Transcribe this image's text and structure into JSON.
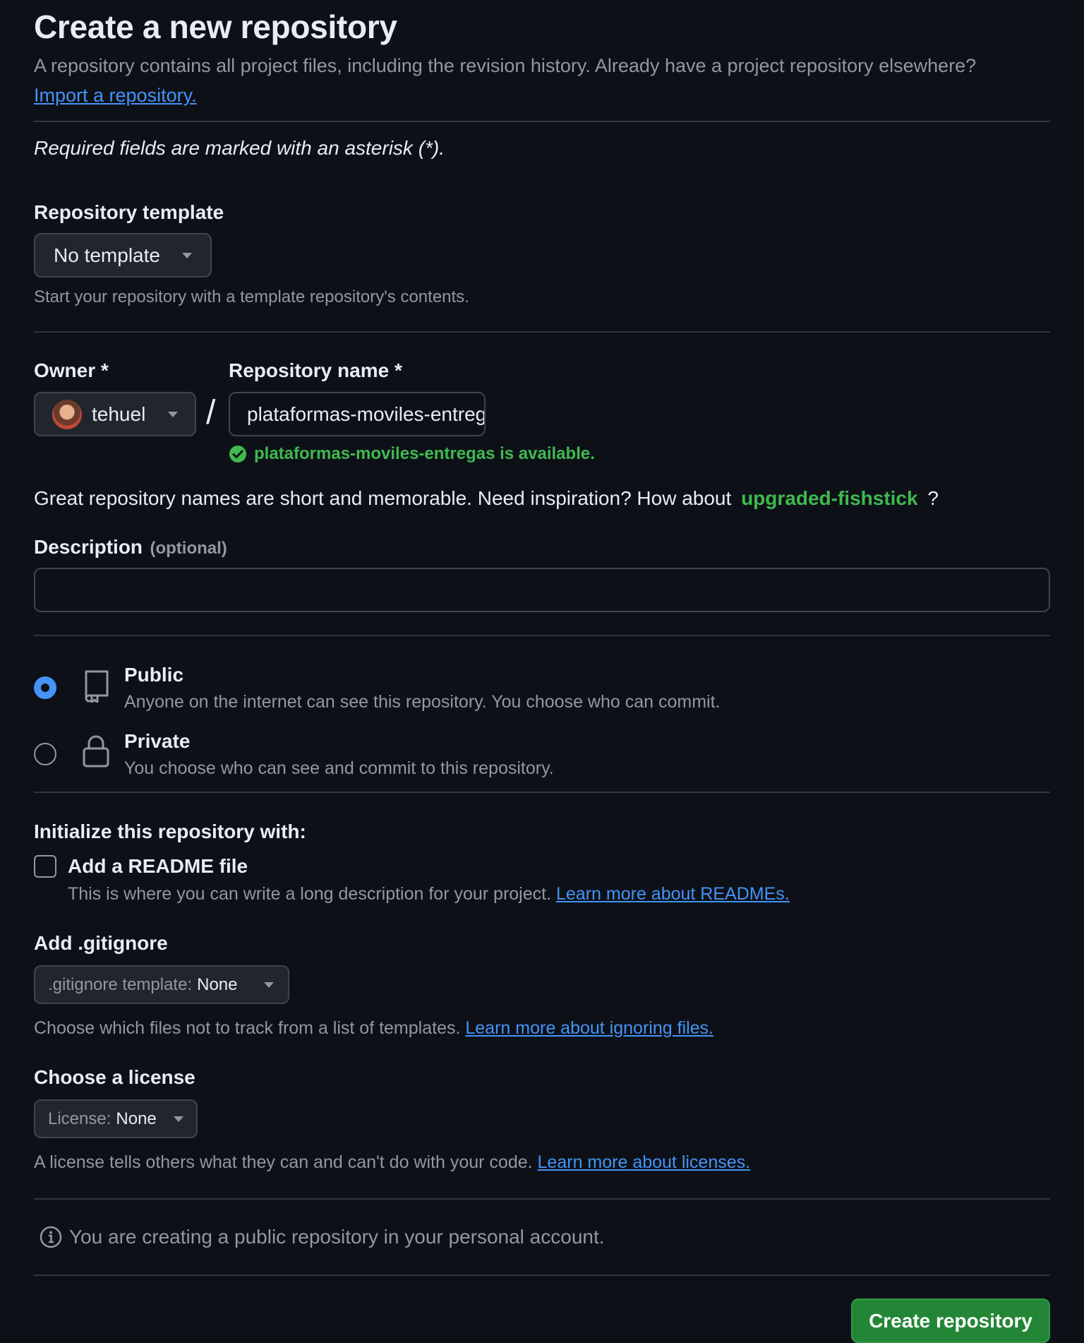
{
  "header": {
    "title": "Create a new repository",
    "intro_text": "A repository contains all project files, including the revision history. Already have a project repository elsewhere?",
    "import_link": "Import a repository."
  },
  "required_note": "Required fields are marked with an asterisk (*).",
  "template": {
    "label": "Repository template",
    "selected": "No template",
    "help": "Start your repository with a template repository's contents."
  },
  "owner": {
    "label": "Owner *",
    "selected": "tehuel",
    "separator": "/"
  },
  "repo_name": {
    "label": "Repository name *",
    "value": "plataformas-moviles-entregas",
    "availability": "plataformas-moviles-entregas is available."
  },
  "suggestion": {
    "text": "Great repository names are short and memorable. Need inspiration? How about",
    "name": "upgraded-fishstick",
    "suffix": "?"
  },
  "description": {
    "label": "Description",
    "optional": "(optional)",
    "value": ""
  },
  "visibility": {
    "selected": "public",
    "options": [
      {
        "title": "Public",
        "desc": "Anyone on the internet can see this repository. You choose who can commit."
      },
      {
        "title": "Private",
        "desc": "You choose who can see and commit to this repository."
      }
    ]
  },
  "initialize": {
    "heading": "Initialize this repository with:",
    "readme_label": "Add a README file",
    "readme_checked": false,
    "readme_desc": "This is where you can write a long description for your project.",
    "readme_link": "Learn more about READMEs."
  },
  "gitignore": {
    "label": "Add .gitignore",
    "prefix": ".gitignore template:",
    "value": "None",
    "help": "Choose which files not to track from a list of templates.",
    "link": "Learn more about ignoring files."
  },
  "license": {
    "label": "Choose a license",
    "prefix": "License:",
    "value": "None",
    "help": "A license tells others what they can and can't do with your code.",
    "link": "Learn more about licenses."
  },
  "notice": "You are creating a public repository in your personal account.",
  "submit_label": "Create repository",
  "colors": {
    "background": "#0d1117",
    "accent_blue": "#4493f8",
    "success_green": "#3fb950",
    "primary_button": "#238636"
  }
}
